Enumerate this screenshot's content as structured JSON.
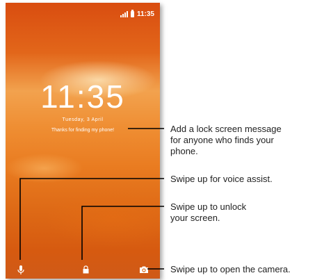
{
  "status_bar": {
    "time": "11:35",
    "icons": [
      "signal-icon",
      "battery-icon"
    ]
  },
  "lock_screen": {
    "clock": "11:35",
    "date": "Tuesday, 3 April",
    "owner_message": "Thanks for finding my phone!",
    "bottom_icons": [
      "mic-icon",
      "lock-icon",
      "camera-icon"
    ]
  },
  "callouts": {
    "message": "Add a lock screen message for anyone who finds your phone.",
    "message_lines": [
      "Add a lock screen message",
      "for anyone who finds your",
      "phone."
    ],
    "voice": "Swipe up for voice assist.",
    "unlock_lines": [
      "Swipe up to unlock",
      "your screen."
    ],
    "camera": "Swipe up to open the camera."
  },
  "colors": {
    "callout_line": "#000000",
    "wallpaper_accent": "#e2661a"
  }
}
